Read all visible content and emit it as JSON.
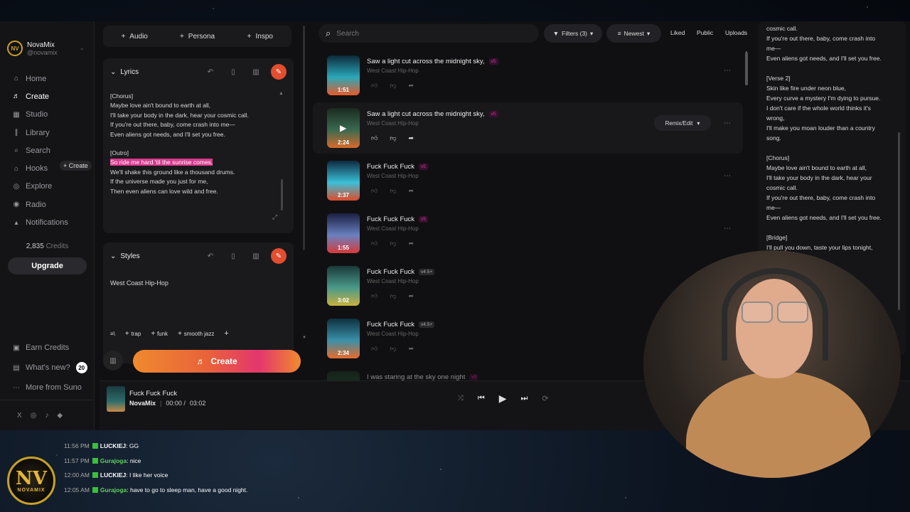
{
  "sidebar": {
    "brand_name": "NovaMix",
    "brand_handle": "@novamix",
    "brand_logo_text": "NV",
    "nav": [
      {
        "label": "Home",
        "icon": "home-icon"
      },
      {
        "label": "Create",
        "icon": "music-note-icon"
      },
      {
        "label": "Studio",
        "icon": "studio-icon"
      },
      {
        "label": "Library",
        "icon": "library-icon"
      },
      {
        "label": "Search",
        "icon": "search-icon"
      },
      {
        "label": "Hooks",
        "icon": "hooks-icon"
      },
      {
        "label": "Explore",
        "icon": "compass-icon"
      },
      {
        "label": "Radio",
        "icon": "radio-icon"
      },
      {
        "label": "Notifications",
        "icon": "bell-icon"
      }
    ],
    "hooks_create_label": "+ Create",
    "credits_count": "2,835",
    "credits_label": "Credits",
    "upgrade_label": "Upgrade",
    "bottom": [
      {
        "label": "Earn Credits"
      },
      {
        "label": "What's new?",
        "badge": "20"
      },
      {
        "label": "More from Suno"
      }
    ],
    "socials": [
      "X",
      "◎",
      "♪",
      "◆"
    ]
  },
  "create_panel": {
    "top_buttons": [
      "Audio",
      "Persona",
      "Inspo"
    ],
    "lyrics_label": "Lyrics",
    "lyrics": [
      "[Chorus]",
      "Maybe love ain't bound to earth at all,",
      "I'll take your body in the dark, hear your cosmic call.",
      "If you're out there, baby, come crash into me—",
      "Even aliens got needs, and I'll set you free.",
      "",
      "[Outro]",
      "So ride me hard 'til the sunrise comes,",
      "We'll shake this ground like a thousand drums.",
      "If the universe made you just for me,",
      "Then even aliens can love wild and free."
    ],
    "highlighted_line_index": 7,
    "styles_label": "Styles",
    "styles_value": "West Coast Hip-Hop",
    "style_tags": [
      "trap",
      "funk",
      "smooth jazz"
    ],
    "create_label": "Create"
  },
  "main": {
    "search_placeholder": "Search",
    "filters_label": "Filters (3)",
    "sort_label": "Newest",
    "liked_label": "Liked",
    "public_label": "Public",
    "uploads_label": "Uploads",
    "remix_label": "Remix/Edit",
    "songs": [
      {
        "title": "Saw a light cut across the midnight sky,",
        "version": "v5",
        "genre": "West Coast Hip-Hop",
        "duration": "1:51",
        "colors": [
          "#0d2a3a",
          "#2aa8b8",
          "#e85a2a"
        ]
      },
      {
        "title": "Saw a light cut across the midnight sky,",
        "version": "v5",
        "genre": "West Coast Hip-Hop",
        "duration": "2:24",
        "colors": [
          "#1a2a20",
          "#3a6a50",
          "#d86a2a"
        ]
      },
      {
        "title": "Fuck Fuck Fuck",
        "version": "v5",
        "genre": "West Coast Hip-Hop",
        "duration": "2:37",
        "colors": [
          "#0e2a40",
          "#3ac0d8",
          "#e04a2a"
        ]
      },
      {
        "title": "Fuck Fuck Fuck",
        "version": "v5",
        "genre": "West Coast Hip-Hop",
        "duration": "1:55",
        "colors": [
          "#1a2040",
          "#6a80c0",
          "#d83a3a"
        ]
      },
      {
        "title": "Fuck Fuck Fuck",
        "version": "v4.5+",
        "genre": "West Coast Hip-Hop",
        "duration": "3:02",
        "colors": [
          "#1a3a3a",
          "#4a9a8a",
          "#c8b040"
        ]
      },
      {
        "title": "Fuck Fuck Fuck",
        "version": "v4.5+",
        "genre": "West Coast Hip-Hop",
        "duration": "2:34",
        "colors": [
          "#0e3040",
          "#3a90a8",
          "#e86a2a"
        ]
      },
      {
        "title": "I was staring at the sky one night",
        "version": "v5",
        "genre": "",
        "duration": "",
        "colors": [
          "#1a3020",
          "#2a5a3a",
          "#2a5a3a"
        ]
      }
    ]
  },
  "lyrics_view": {
    "lines": [
      "cosmic call.",
      "If you're out there, baby, come crash into",
      "me—",
      "Even aliens got needs, and I'll set you free.",
      "",
      "[Verse 2]",
      "Skin like fire under neon blue,",
      "Every curve a mystery I'm dying to pursue.",
      "I don't care if the whole world thinks it's",
      "wrong,",
      "I'll make you moan louder than a country",
      "song.",
      "",
      "[Chorus]",
      "Maybe love ain't bound to earth at all,",
      "I'll take your body in the dark, hear your",
      "cosmic call.",
      "If you're out there, baby, come crash into",
      "me—",
      "Even aliens got needs, and I'll set you free.",
      "",
      "[Bridge]",
      "I'll pull you down, taste your lips tonight,"
    ]
  },
  "player": {
    "title": "Fuck Fuck Fuck",
    "artist": "NovaMix",
    "current_time": "00:00",
    "total_time": "03:02"
  },
  "chat": [
    {
      "time": "11:56 PM",
      "user": "LUCKIEJ",
      "msg": "GG",
      "style": "u1"
    },
    {
      "time": "11:57 PM",
      "user": "Gurajoga",
      "msg": "nice",
      "style": "u2"
    },
    {
      "time": "12:00 AM",
      "user": "LUCKIEJ",
      "msg": "I like her voice",
      "style": "u1"
    },
    {
      "time": "12:05 AM",
      "user": "Gurajoga",
      "msg": "have to go to sleep man, have a good night.",
      "style": "u2"
    }
  ],
  "overlay_logo": {
    "top": "NV",
    "bottom": "NOVAMIX"
  },
  "colors": {
    "accent": "#e24e2e",
    "highlight": "#d83b8f",
    "version_tag": "#d0358f"
  }
}
